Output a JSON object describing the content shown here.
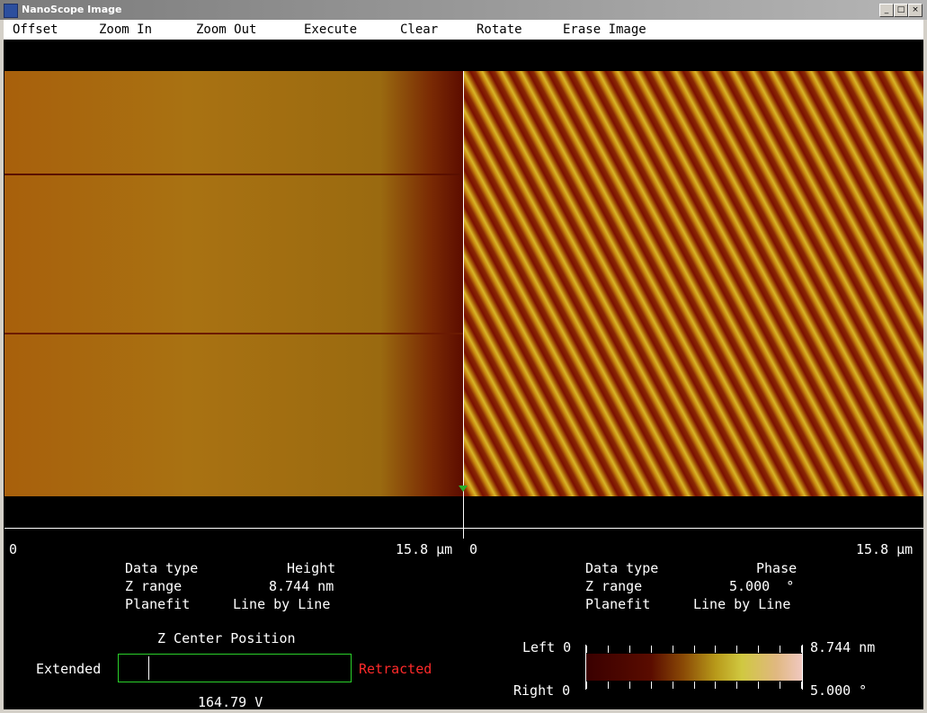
{
  "window": {
    "title": "NanoScope Image"
  },
  "menu": {
    "items": [
      "Offset",
      "Zoom In",
      "Zoom Out",
      "Execute",
      "Clear",
      "Rotate",
      "Erase Image"
    ]
  },
  "left_panel": {
    "axis_start": "0",
    "axis_end": "15.8 µm",
    "data_type_label": "Data type",
    "data_type_value": "Height",
    "z_range_label": "Z range",
    "z_range_value": "8.744 nm",
    "planefit_label": "Planefit",
    "planefit_value": "Line by Line"
  },
  "right_panel": {
    "axis_start": "0",
    "axis_end": "15.8 µm",
    "data_type_label": "Data type",
    "data_type_value": "Phase",
    "z_range_label": "Z range",
    "z_range_value": "5.000  °",
    "planefit_label": "Planefit",
    "planefit_value": "Line by Line"
  },
  "z_center": {
    "title": "Z Center Position",
    "left_label": "Extended",
    "right_label": "Retracted",
    "voltage": "164.79 V",
    "position_fraction": 0.13
  },
  "color_scale": {
    "left_label": "Left 0",
    "right_label": "Right 0",
    "top_value": "8.744 nm",
    "bottom_value": "5.000 °"
  },
  "colors": {
    "background": "#000000",
    "text": "#ffffff",
    "retracted": "#ff2a2a",
    "bar_border": "#2ad02a"
  }
}
